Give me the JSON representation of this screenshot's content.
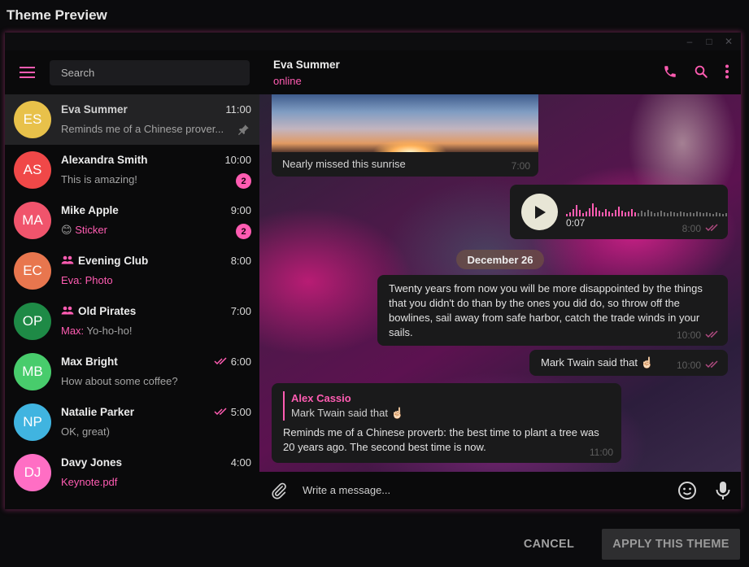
{
  "dialog": {
    "title": "Theme Preview",
    "cancel": "CANCEL",
    "apply": "APPLY THIS THEME"
  },
  "window_controls": [
    "minimize-icon",
    "maximize-icon",
    "close-icon"
  ],
  "colors": {
    "accent": "#ff5cb2",
    "background": "#000000",
    "bubble": "#1a1a1b"
  },
  "sidebar": {
    "search_placeholder": "Search",
    "chats": [
      {
        "initials": "ES",
        "avatar_color": "#e8c14a",
        "name": "Eva Summer",
        "time": "11:00",
        "preview": "Reminds me of a Chinese prover...",
        "pinned": true,
        "active": true
      },
      {
        "initials": "AS",
        "avatar_color": "#f04848",
        "name": "Alexandra Smith",
        "time": "10:00",
        "preview": "This is amazing!",
        "badge": "2"
      },
      {
        "initials": "MA",
        "avatar_color": "#f0546c",
        "name": "Mike Apple",
        "time": "9:00",
        "preview_emoji": "😊",
        "preview_highlight": "Sticker",
        "badge": "2"
      },
      {
        "initials": "EC",
        "avatar_color": "#e8764e",
        "name": "Evening Club",
        "time": "8:00",
        "group": true,
        "preview_highlight": "Eva: Photo"
      },
      {
        "initials": "OP",
        "avatar_color": "#1e8a46",
        "name": "Old Pirates",
        "time": "7:00",
        "group": true,
        "preview_highlight": "Max:",
        "preview": " Yo-ho-ho!"
      },
      {
        "initials": "MB",
        "avatar_color": "#48cc6c",
        "name": "Max Bright",
        "time": "6:00",
        "read": true,
        "preview": "How about some coffee?"
      },
      {
        "initials": "NP",
        "avatar_color": "#40b4e0",
        "name": "Natalie Parker",
        "time": "5:00",
        "read": true,
        "preview": "OK, great)"
      },
      {
        "initials": "DJ",
        "avatar_color": "#ff6ec4",
        "name": "Davy Jones",
        "time": "4:00",
        "preview_highlight": "Keynote.pdf"
      }
    ]
  },
  "chat": {
    "name": "Eva Summer",
    "status": "online",
    "header_icons": [
      "phone-icon",
      "search-icon",
      "more-icon"
    ],
    "photo": {
      "caption": "Nearly missed this sunrise",
      "time": "7:00"
    },
    "voice": {
      "duration": "0:07",
      "time": "8:00"
    },
    "date": "December 26",
    "msg_long": {
      "text": "Twenty years from now you will be more disappointed by the things that you didn't do than by the ones you did do, so throw off the bowlines, sail away from safe harbor, catch the trade winds in your sails.",
      "time": "10:00"
    },
    "msg_mark": {
      "text": "Mark Twain said that ☝🏻",
      "time": "10:00"
    },
    "msg_reply": {
      "quote_name": "Alex Cassio",
      "quote_text": "Mark Twain said that ☝🏻",
      "text": "Reminds me of a Chinese proverb: the best time to plant a tree was 20 years ago. The second best time is now.",
      "time": "11:00"
    },
    "composer_placeholder": "Write a message..."
  }
}
